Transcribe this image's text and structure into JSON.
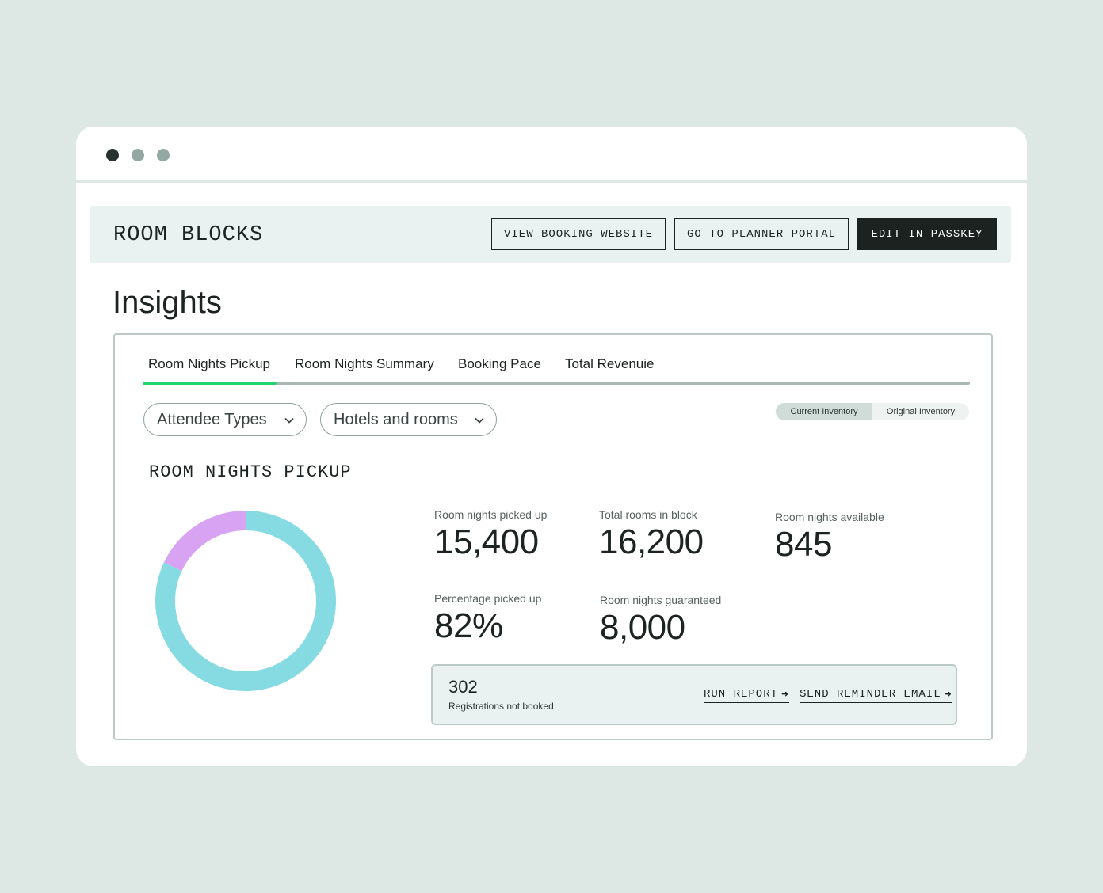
{
  "header": {
    "title": "ROOM BLOCKS",
    "buttons": {
      "view_booking": "VIEW BOOKING WEBSITE",
      "planner_portal": "GO TO PLANNER PORTAL",
      "edit_passkey": "EDIT IN PASSKEY"
    }
  },
  "page": {
    "title": "Insights"
  },
  "tabs": [
    {
      "label": "Room Nights Pickup",
      "active": true
    },
    {
      "label": "Room Nights Summary",
      "active": false
    },
    {
      "label": "Booking Pace",
      "active": false
    },
    {
      "label": "Total Revenuie",
      "active": false
    }
  ],
  "filters": [
    {
      "label": "Attendee Types",
      "icon": "chevron-down-icon"
    },
    {
      "label": "Hotels and rooms",
      "icon": "chevron-down-icon"
    }
  ],
  "inventory_toggle": {
    "options": [
      "Current Inventory",
      "Original Inventory"
    ],
    "selected": "Current Inventory"
  },
  "section": {
    "title": "ROOM NIGHTS PICKUP"
  },
  "stats": [
    {
      "label": "Room nights picked up",
      "value": "15,400"
    },
    {
      "label": "Total rooms in block",
      "value": "16,200"
    },
    {
      "label": "Room nights available",
      "value": "845"
    },
    {
      "label": "Percentage picked up",
      "value": "82%"
    },
    {
      "label": "Room nights guaranteed",
      "value": "8,000"
    }
  ],
  "registrations": {
    "count": "302",
    "label": "Registrations not booked",
    "run_report": "RUN REPORT",
    "send_reminder": "SEND REMINDER EMAIL"
  },
  "chart_data": {
    "type": "pie",
    "donut": true,
    "slices": [
      {
        "value": 82,
        "color": "#86dbe3"
      },
      {
        "value": 18,
        "color": "#d8a3f2"
      }
    ]
  },
  "colors": {
    "accent": "#1fd56d",
    "primary_button": "#1b2220",
    "background": "#dde8e5"
  }
}
